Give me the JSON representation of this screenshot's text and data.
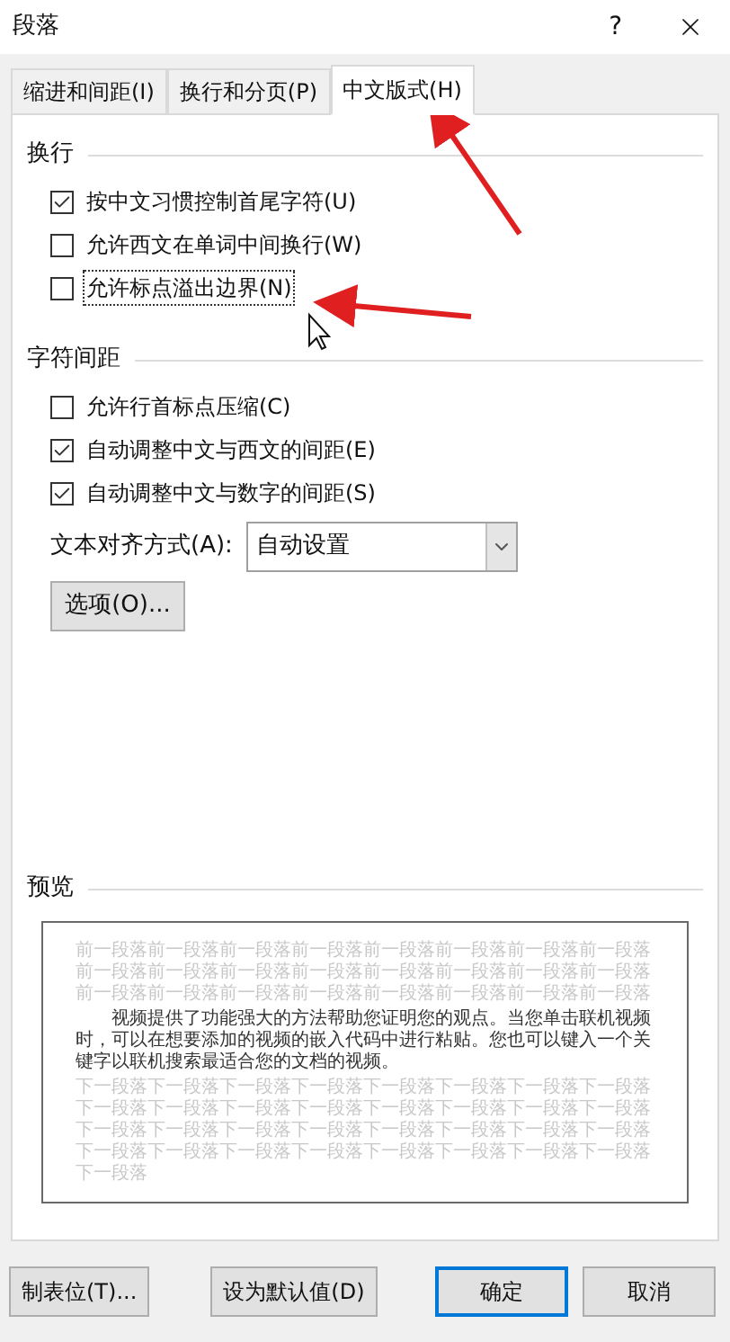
{
  "window": {
    "title": "段落",
    "help": "?"
  },
  "tabs": [
    {
      "label": "缩进和间距(I)",
      "selected": false
    },
    {
      "label": "换行和分页(P)",
      "selected": false
    },
    {
      "label": "中文版式(H)",
      "selected": true
    }
  ],
  "line_break": {
    "title": "换行",
    "options": [
      {
        "label": "按中文习惯控制首尾字符(U)",
        "checked": true,
        "focused": false
      },
      {
        "label": "允许西文在单词中间换行(W)",
        "checked": false,
        "focused": false
      },
      {
        "label": "允许标点溢出边界(N)",
        "checked": false,
        "focused": true
      }
    ]
  },
  "char_spacing": {
    "title": "字符间距",
    "options": [
      {
        "label": "允许行首标点压缩(C)",
        "checked": false,
        "focused": false
      },
      {
        "label": "自动调整中文与西文的间距(E)",
        "checked": true,
        "focused": false
      },
      {
        "label": "自动调整中文与数字的间距(S)",
        "checked": true,
        "focused": false
      }
    ],
    "alignment": {
      "label": "文本对齐方式(A):",
      "value": "自动设置"
    },
    "options_button": "选项(O)..."
  },
  "preview": {
    "title": "预览",
    "previous": "前一段落前一段落前一段落前一段落前一段落前一段落前一段落前一段落前一段落前一段落前一段落前一段落前一段落前一段落前一段落前一段落前一段落前一段落前一段落前一段落前一段落前一段落前一段落前一段落",
    "body": "视频提供了功能强大的方法帮助您证明您的观点。当您单击联机视频时，可以在想要添加的视频的嵌入代码中进行粘贴。您也可以键入一个关键字以联机搜索最适合您的文档的视频。",
    "next": "下一段落下一段落下一段落下一段落下一段落下一段落下一段落下一段落下一段落下一段落下一段落下一段落下一段落下一段落下一段落下一段落下一段落下一段落下一段落下一段落下一段落下一段落下一段落下一段落下一段落下一段落下一段落下一段落下一段落下一段落下一段落下一段落下一段落"
  },
  "buttons": [
    {
      "label": "制表位(T)...",
      "default": false
    },
    {
      "label": "设为默认值(D)",
      "default": false
    },
    {
      "label": "确定",
      "default": true
    },
    {
      "label": "取消",
      "default": false
    }
  ]
}
